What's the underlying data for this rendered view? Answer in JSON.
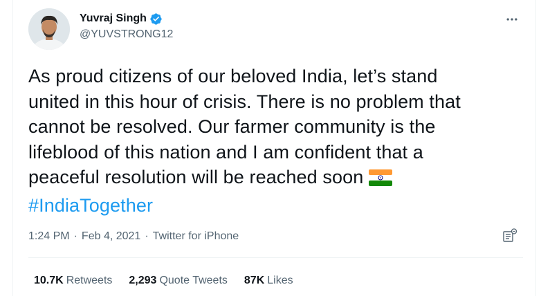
{
  "tweet": {
    "author": {
      "display_name": "Yuvraj Singh",
      "handle": "@YUVSTRONG12",
      "verified": true,
      "verified_icon": "verified-badge-icon",
      "avatar_icon": "profile-avatar"
    },
    "text_lines": [
      "As proud citizens of our beloved India, let’s stand",
      "united in this hour of crisis. There is no problem that",
      "cannot be resolved. Our farmer community is the",
      "lifeblood of this nation and I am confident that a",
      "peaceful resolution will be reached soon"
    ],
    "flag_emoji": "india-flag-icon",
    "hashtag": "#IndiaTogether",
    "time": "1:24 PM",
    "date": "Feb 4, 2021",
    "source": "Twitter for iPhone",
    "separator": "·"
  },
  "stats": {
    "retweets_count": "10.7K",
    "retweets_label": "Retweets",
    "quote_count": "2,293",
    "quote_label": "Quote Tweets",
    "likes_count": "87K",
    "likes_label": "Likes"
  },
  "colors": {
    "accent": "#1d9bf0",
    "text": "#0f1419",
    "secondary": "#536471",
    "border": "#eff3f4"
  }
}
